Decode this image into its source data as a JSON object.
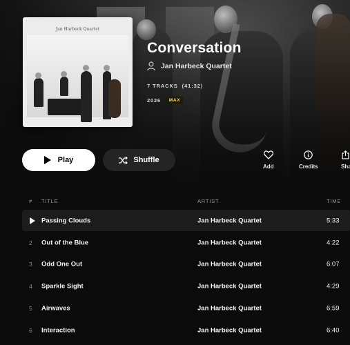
{
  "album": {
    "title": "Conversation",
    "artist": "Jan Harbeck Quartet",
    "tracks_summary": "7 TRACKS  (41:32)",
    "year": "2026",
    "quality_badge": "MAX",
    "art_title": "Jan Harbeck Quartet"
  },
  "actions": {
    "play": "Play",
    "shuffle": "Shuffle",
    "add": "Add",
    "credits": "Credits",
    "share": "Share"
  },
  "table": {
    "columns": {
      "num": "#",
      "title": "TITLE",
      "artist": "ARTIST",
      "time": "TIME"
    },
    "rows": [
      {
        "num": "",
        "title": "Passing Clouds",
        "artist": "Jan Harbeck Quartet",
        "time": "5:33",
        "active": true
      },
      {
        "num": "2",
        "title": "Out of the Blue",
        "artist": "Jan Harbeck Quartet",
        "time": "4:22"
      },
      {
        "num": "3",
        "title": "Odd One Out",
        "artist": "Jan Harbeck Quartet",
        "time": "6:07"
      },
      {
        "num": "4",
        "title": "Sparkle Sight",
        "artist": "Jan Harbeck Quartet",
        "time": "4:29"
      },
      {
        "num": "5",
        "title": "Airwaves",
        "artist": "Jan Harbeck Quartet",
        "time": "6:59"
      },
      {
        "num": "6",
        "title": "Interaction",
        "artist": "Jan Harbeck Quartet",
        "time": "6:40"
      }
    ]
  },
  "colors": {
    "accent_badge": "#ffd84a",
    "background": "#0b0b0b",
    "row_highlight": "#1c1c1c"
  }
}
